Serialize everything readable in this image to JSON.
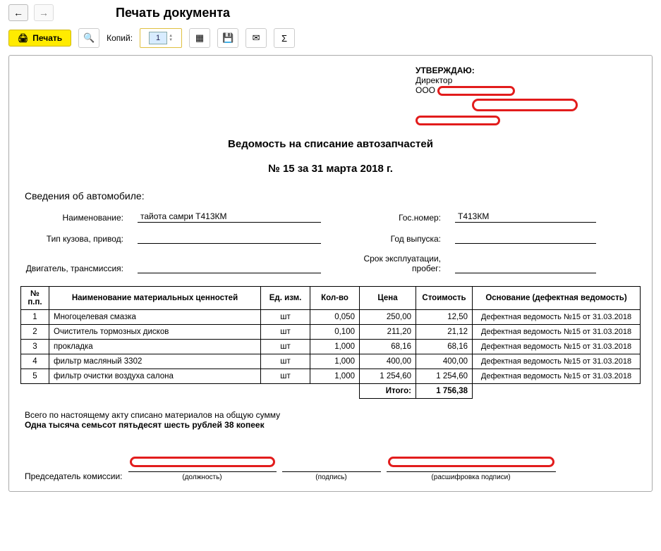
{
  "window": {
    "title": "Печать документа"
  },
  "toolbar": {
    "print_label": "Печать",
    "copies_label": "Копий:",
    "copies_value": "1"
  },
  "approval": {
    "title": "УТВЕРЖДАЮ:",
    "line1": "Директор",
    "line2_prefix": "ООО"
  },
  "heading": {
    "line1": "Ведомость на списание автозапчастей",
    "line2": "№ 15 за 31 марта 2018 г."
  },
  "vehicle_section_title": "Сведения об автомобиле:",
  "fields": {
    "name_label": "Наименование:",
    "name_value": "тайота самри Т413КМ",
    "gosnomer_label": "Гос.номер:",
    "gosnomer_value": "Т413КМ",
    "body_label": "Тип кузова, привод:",
    "body_value": "",
    "year_label": "Год выпуска:",
    "year_value": "",
    "engine_label": "Двигатель, трансмиссия:",
    "engine_value": "",
    "mileage_label": "Срок эксплуатации, пробег:",
    "mileage_value": ""
  },
  "columns": {
    "num": "№ п.п.",
    "name": "Наименование материальных ценностей",
    "unit": "Ед. изм.",
    "qty": "Кол-во",
    "price": "Цена",
    "cost": "Стоимость",
    "basis": "Основание (дефектная ведомость)"
  },
  "rows": [
    {
      "n": "1",
      "name": "Многоцелевая смазка",
      "unit": "шт",
      "qty": "0,050",
      "price": "250,00",
      "cost": "12,50",
      "basis": "Дефектная ведомость №15 от 31.03.2018"
    },
    {
      "n": "2",
      "name": "Очиститель тормозных дисков",
      "unit": "шт",
      "qty": "0,100",
      "price": "211,20",
      "cost": "21,12",
      "basis": "Дефектная ведомость №15 от 31.03.2018"
    },
    {
      "n": "3",
      "name": "прокладка",
      "unit": "шт",
      "qty": "1,000",
      "price": "68,16",
      "cost": "68,16",
      "basis": "Дефектная ведомость №15 от 31.03.2018"
    },
    {
      "n": "4",
      "name": "фильтр масляный 3302",
      "unit": "шт",
      "qty": "1,000",
      "price": "400,00",
      "cost": "400,00",
      "basis": "Дефектная ведомость №15 от 31.03.2018"
    },
    {
      "n": "5",
      "name": "фильтр очистки воздуха салона",
      "unit": "шт",
      "qty": "1,000",
      "price": "1 254,60",
      "cost": "1 254,60",
      "basis": "Дефектная ведомость №15 от 31.03.2018"
    }
  ],
  "totals": {
    "label": "Итого:",
    "value": "1 756,38"
  },
  "summary": {
    "line1": "Всего по настоящему акту списано материалов на общую сумму",
    "line2": "Одна тысяча семьсот пятьдесят шесть рублей 38 копеек"
  },
  "sign": {
    "chairman": "Председатель комиссии:",
    "position_cap": "(должность)",
    "signature_cap": "(подпись)",
    "decipher_cap": "(расшифровка подписи)"
  },
  "chart_data": {
    "type": "table",
    "title": "Ведомость на списание автозапчастей № 15 за 31 марта 2018 г.",
    "columns": [
      "№ п.п.",
      "Наименование материальных ценностей",
      "Ед. изм.",
      "Кол-во",
      "Цена",
      "Стоимость",
      "Основание (дефектная ведомость)"
    ],
    "rows": [
      [
        1,
        "Многоцелевая смазка",
        "шт",
        0.05,
        250.0,
        12.5,
        "Дефектная ведомость №15 от 31.03.2018"
      ],
      [
        2,
        "Очиститель тормозных дисков",
        "шт",
        0.1,
        211.2,
        21.12,
        "Дефектная ведомость №15 от 31.03.2018"
      ],
      [
        3,
        "прокладка",
        "шт",
        1.0,
        68.16,
        68.16,
        "Дефектная ведомость №15 от 31.03.2018"
      ],
      [
        4,
        "фильтр масляный 3302",
        "шт",
        1.0,
        400.0,
        400.0,
        "Дефектная ведомость №15 от 31.03.2018"
      ],
      [
        5,
        "фильтр очистки воздуха салона",
        "шт",
        1.0,
        1254.6,
        1254.6,
        "Дефектная ведомость №15 от 31.03.2018"
      ]
    ],
    "total": 1756.38
  }
}
